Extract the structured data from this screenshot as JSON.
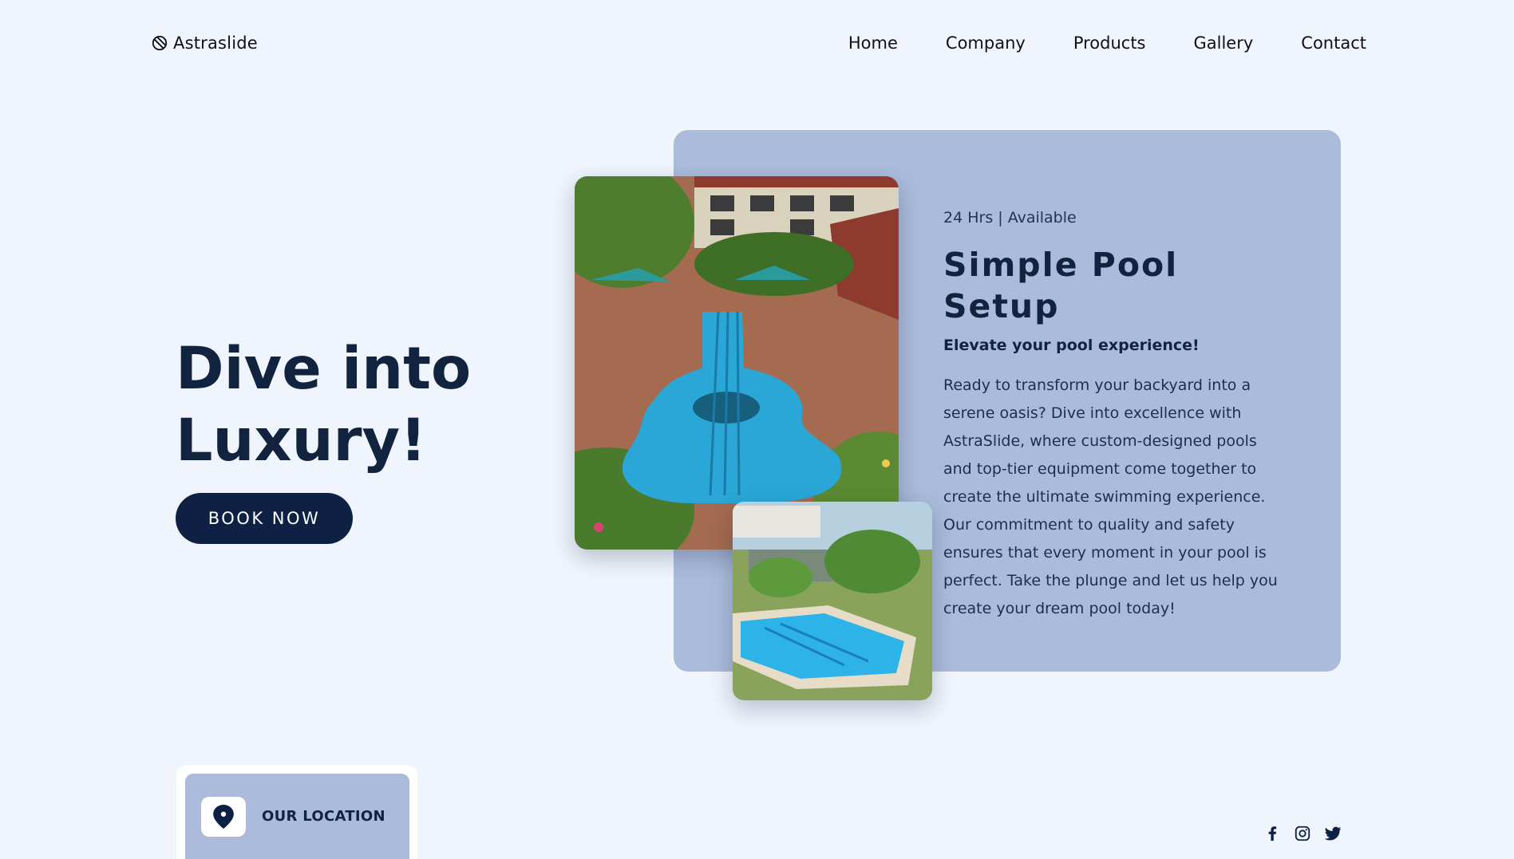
{
  "brand": {
    "name": "Astraslide"
  },
  "nav": {
    "items": [
      {
        "label": "Home"
      },
      {
        "label": "Company"
      },
      {
        "label": "Products"
      },
      {
        "label": "Gallery"
      },
      {
        "label": "Contact"
      }
    ]
  },
  "hero": {
    "title_line1": "Dive into",
    "title_line2": "Luxury!",
    "cta_label": "BOOK NOW"
  },
  "card": {
    "eyebrow": "24 Hrs | Available",
    "title": "Simple Pool Setup",
    "subtitle": "Elevate your pool experience!",
    "body": "Ready to transform your backyard into a serene oasis? Dive into excellence with AstraSlide, where custom-designed pools and top-tier equipment come together to create the ultimate swimming experience. Our commitment to quality and safety ensures that every moment in your pool is perfect. Take the plunge and let us help you create your dream pool today!"
  },
  "location": {
    "label": "OUR LOCATION",
    "icon": "map-pin-icon"
  },
  "social": {
    "icons": [
      "facebook-icon",
      "instagram-icon",
      "twitter-icon"
    ]
  },
  "colors": {
    "background": "#eff4fd",
    "navy": "#0e2043",
    "card": "#abbbdb",
    "white": "#ffffff"
  }
}
